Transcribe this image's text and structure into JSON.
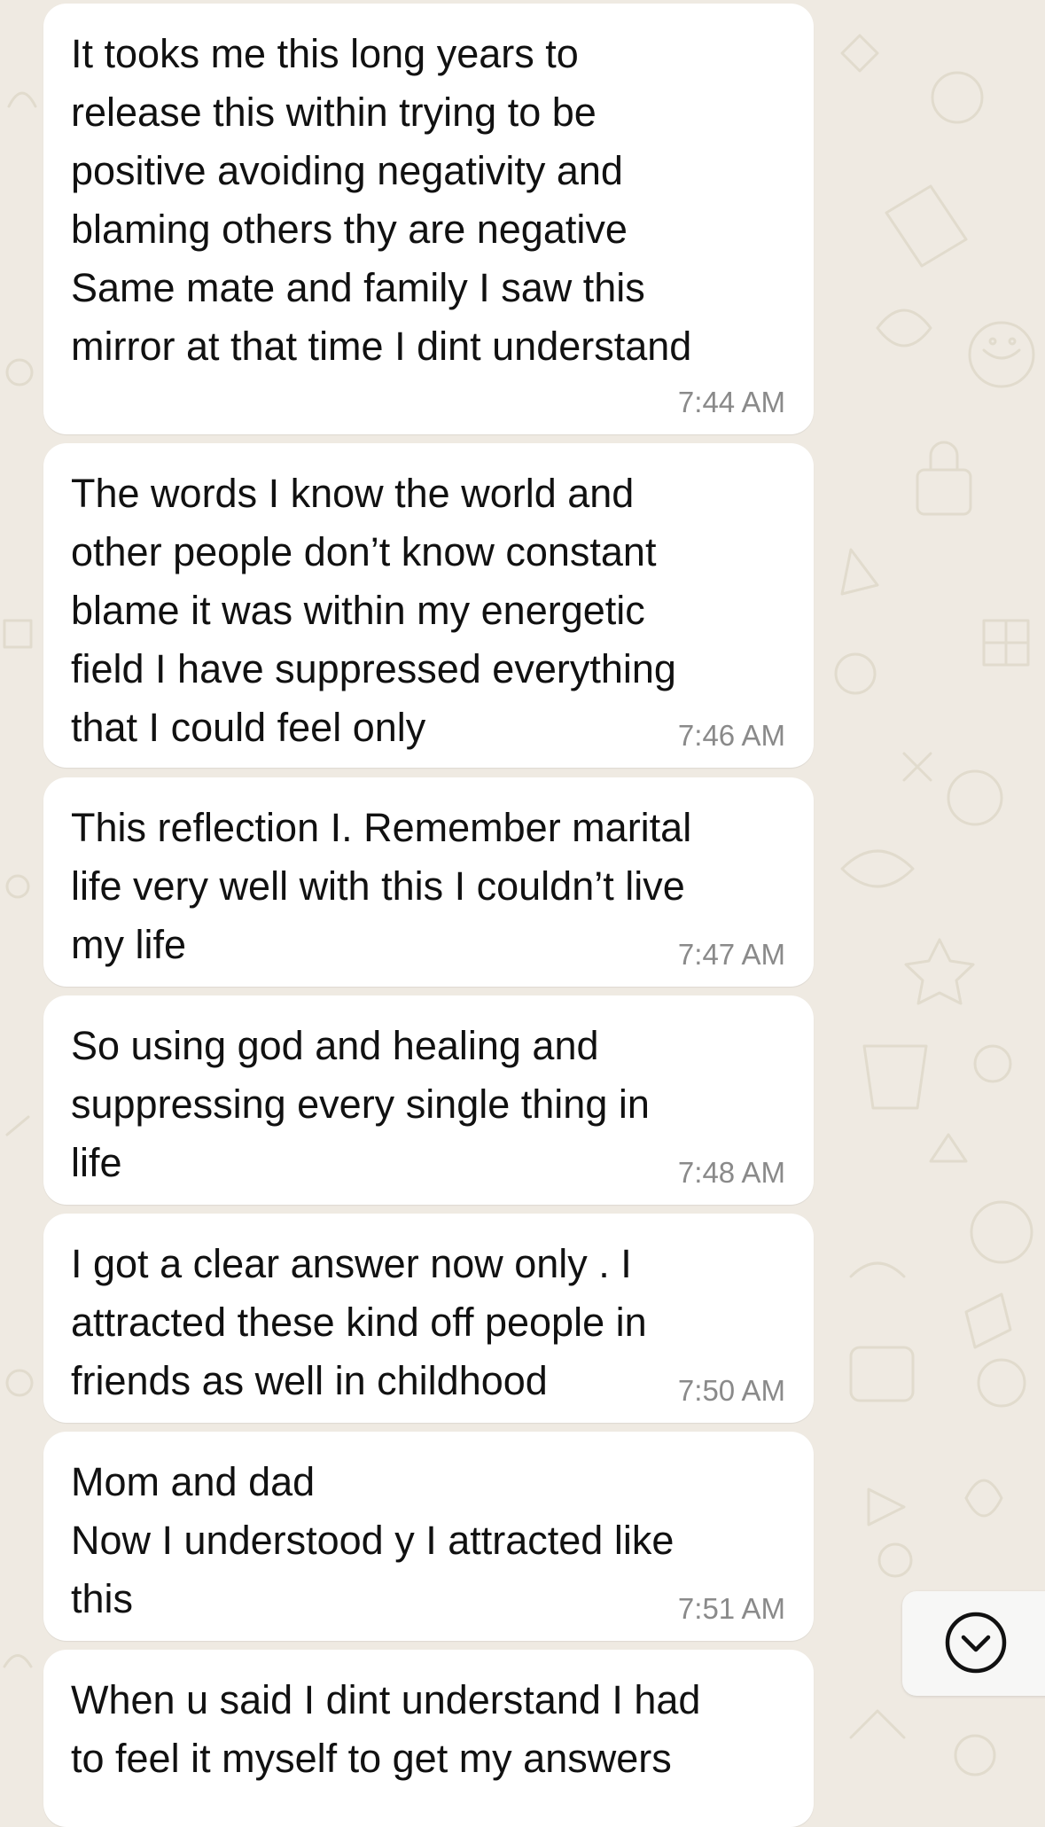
{
  "messages": [
    {
      "text": "It tooks me this long years to\nrelease this within trying to be\npositive avoiding negativity and\nblaming others thy are negative\nSame mate and family I saw this\nmirror at that time I dint understand",
      "time": "7:44 AM"
    },
    {
      "text": "The words I know the world and\nother people don’t know constant\nblame it was within my energetic\nfield I have suppressed everything\nthat I could feel only",
      "time": "7:46 AM"
    },
    {
      "text": "This reflection I. Remember marital\nlife very well with this I couldn’t live\nmy life",
      "time": "7:47 AM"
    },
    {
      "text": "So using god and healing and\nsuppressing every single thing in\nlife",
      "time": "7:48 AM"
    },
    {
      "text": "I got a clear answer now only . I\nattracted these kind off people in\nfriends as well in childhood",
      "time": "7:50 AM"
    },
    {
      "text": "Mom and dad\nNow I understood y I attracted like\nthis",
      "time": "7:51 AM"
    },
    {
      "text": "When u said I dint understand I had\nto feel it myself to get my answers",
      "time": ""
    }
  ],
  "scroll_button": {
    "icon": "chevron-down-circle-icon"
  },
  "colors": {
    "background": "#efeae2",
    "bubble": "#ffffff",
    "text": "#111111",
    "timestamp": "#8a8a8a",
    "doodle": "#e2dccf"
  }
}
